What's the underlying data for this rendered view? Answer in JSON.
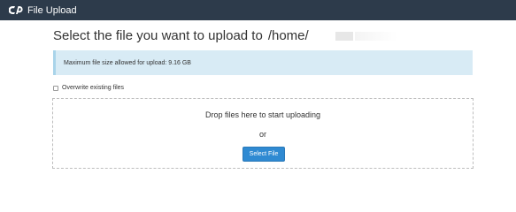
{
  "header": {
    "logo_icon": "cpanel-logo-icon",
    "title": "File Upload"
  },
  "main": {
    "heading_text": "Select the file you want to upload to",
    "heading_path": "/home/"
  },
  "alert": {
    "text": "Maximum file size allowed for upload: 9.16 GB"
  },
  "options": {
    "overwrite_label": "Overwrite existing files",
    "overwrite_checked": false
  },
  "dropzone": {
    "text": "Drop files here to start uploading",
    "or_text": "or",
    "select_label": "Select File"
  },
  "colors": {
    "header_bg": "#2d3b4b",
    "alert_bg": "#d8ebf5",
    "button_bg": "#2f8ad2"
  }
}
